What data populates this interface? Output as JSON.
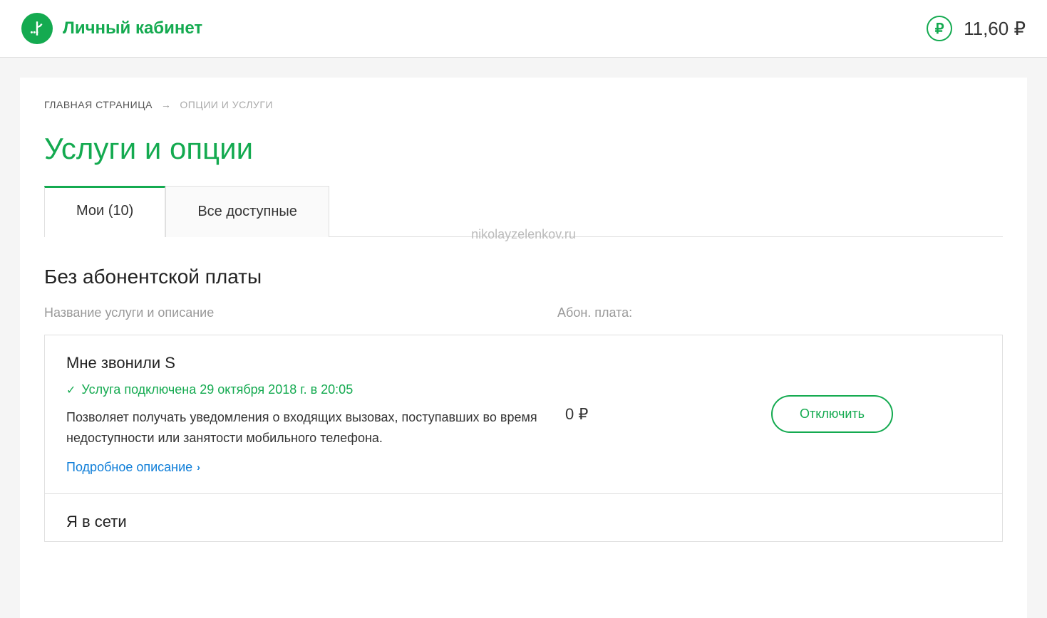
{
  "header": {
    "logo_text": "Личный кабинет",
    "balance": "11,60 ₽"
  },
  "breadcrumb": {
    "home": "ГЛАВНАЯ СТРАНИЦА",
    "arrow": "→",
    "current": "ОПЦИИ И УСЛУГИ"
  },
  "page_title": "Услуги и опции",
  "tabs": {
    "my": "Мои (10)",
    "all": "Все доступные"
  },
  "watermark": "nikolayzelenkov.ru",
  "section": {
    "title": "Без абонентской платы",
    "col_name": "Название услуги и описание",
    "col_fee": "Абон. плата:"
  },
  "services": [
    {
      "name": "Мне звонили S",
      "status": "Услуга подключена 29 октября 2018 г. в 20:05",
      "description": "Позволяет получать уведомления о входящих вызовах, поступавших во время недоступности или занятости мобильного телефона.",
      "details_label": "Подробное описание",
      "fee": "0 ₽",
      "action_label": "Отключить"
    },
    {
      "name": "Я в сети"
    }
  ]
}
